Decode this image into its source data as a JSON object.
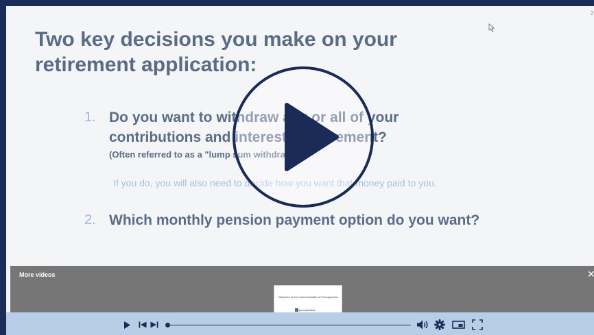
{
  "slide": {
    "number": "2",
    "title": "Two key decisions you make on your retirement application:",
    "questions": [
      {
        "number": "1.",
        "line1": "Do you want to withdraw any or all of your",
        "line2": "contributions and interest at retirement?",
        "note": "(Often referred to as a \"lump sum withdrawal\")",
        "sub": "If you do, you will also need to decide how you want that money paid to you."
      },
      {
        "number": "2.",
        "line1": "Which monthly pension payment option do you want?"
      }
    ]
  },
  "more_videos": {
    "title": "More videos",
    "close": "✕",
    "thumbnail": {
      "text": "Welcome to the Commonwealth of Pennsylvania",
      "logo": "pennsylvania"
    }
  },
  "player": {
    "progress": 0
  },
  "colors": {
    "border": "#1b2c58",
    "title": "#5a6b86",
    "accent_number": "#9db6d8",
    "control_bar": "#b7cee6",
    "play_circle": "#1a2b57"
  }
}
